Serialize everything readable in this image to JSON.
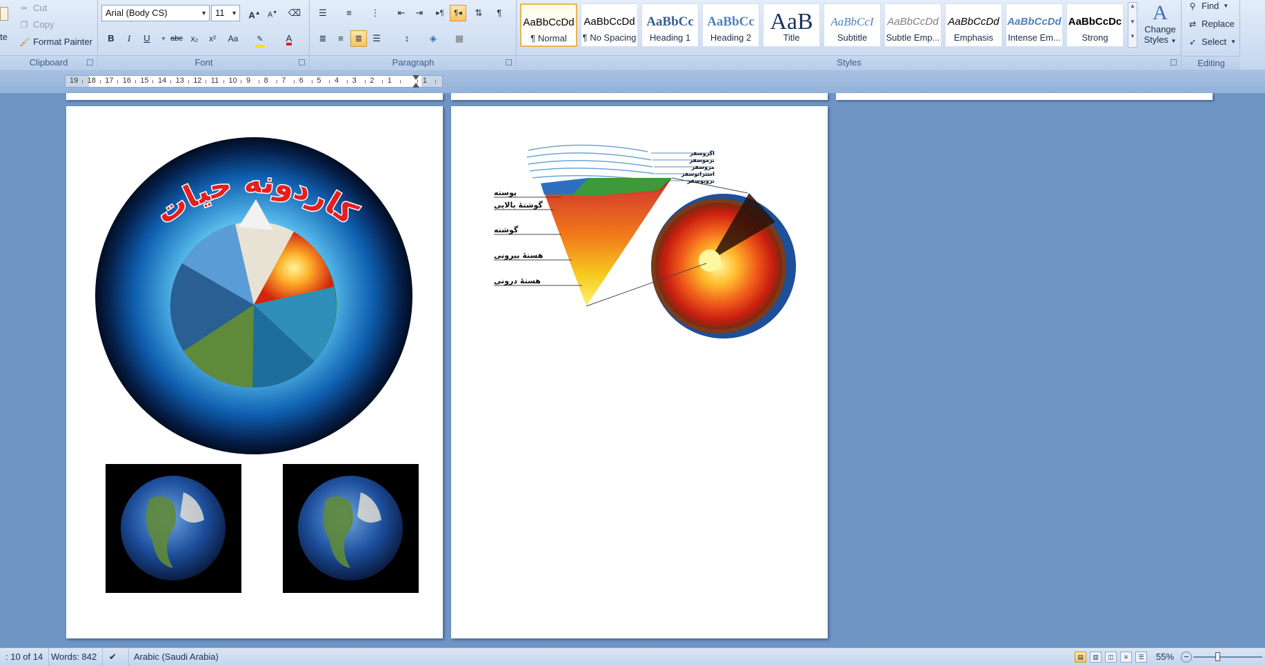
{
  "clipboard": {
    "paste_label": "te",
    "cut_label": "Cut",
    "copy_label": "Copy",
    "format_painter_label": "Format Painter",
    "group_label": "Clipboard"
  },
  "font": {
    "family_value": "Arial (Body CS)",
    "size_value": "11",
    "group_label": "Font",
    "bold": "B",
    "italic": "I",
    "underline": "U",
    "strike": "abc",
    "subscript": "x₂",
    "superscript": "x²",
    "change_case": "Aa",
    "grow": "A",
    "shrink": "A",
    "font_color": "A"
  },
  "paragraph": {
    "group_label": "Paragraph",
    "pilcrow": "¶"
  },
  "styles": {
    "group_label": "Styles",
    "tiles": [
      {
        "sample": "AaBbCcDd",
        "name": "¶ Normal"
      },
      {
        "sample": "AaBbCcDd",
        "name": "¶ No Spacing"
      },
      {
        "sample": "AaBbCc",
        "name": "Heading 1"
      },
      {
        "sample": "AaBbCc",
        "name": "Heading 2"
      },
      {
        "sample": "AaB",
        "name": "Title"
      },
      {
        "sample": "AaBbCcI",
        "name": "Subtitle"
      },
      {
        "sample": "AaBbCcDd",
        "name": "Subtle Emp..."
      },
      {
        "sample": "AaBbCcDd",
        "name": "Emphasis"
      },
      {
        "sample": "AaBbCcDd",
        "name": "Intense Em..."
      },
      {
        "sample": "AaBbCcDc",
        "name": "Strong"
      }
    ],
    "change_styles_line1": "Change",
    "change_styles_line2": "Styles"
  },
  "editing": {
    "find_label": "Find",
    "replace_label": "Replace",
    "select_label": "Select",
    "group_label": "Editing"
  },
  "ruler": {
    "numbers": [
      "19",
      "18",
      "17",
      "16",
      "15",
      "14",
      "13",
      "12",
      "11",
      "10",
      "9",
      "8",
      "7",
      "6",
      "5",
      "4",
      "3",
      "2",
      "1",
      "",
      "1"
    ]
  },
  "page1": {
    "poster_title": "کاردونه حیات"
  },
  "page2": {
    "atmosphere_labels": [
      "اگزوسفر",
      "ترموسفر",
      "مزوسفر",
      "استراتوسفر",
      "تروپوسفر"
    ],
    "earth_labels": [
      "پوسته",
      "گوشتهٔ بالایی",
      "گوشته",
      "هستهٔ بیرونی",
      "هستهٔ درونی"
    ]
  },
  "status": {
    "page": ": 10 of 14",
    "words": "Words: 842",
    "language": "Arabic (Saudi Arabia)",
    "zoom": "55%"
  },
  "colors": {
    "ribbon_top": "#e4edf9",
    "workspace": "#6f95c4",
    "accent_selected": "#f8c35f"
  }
}
